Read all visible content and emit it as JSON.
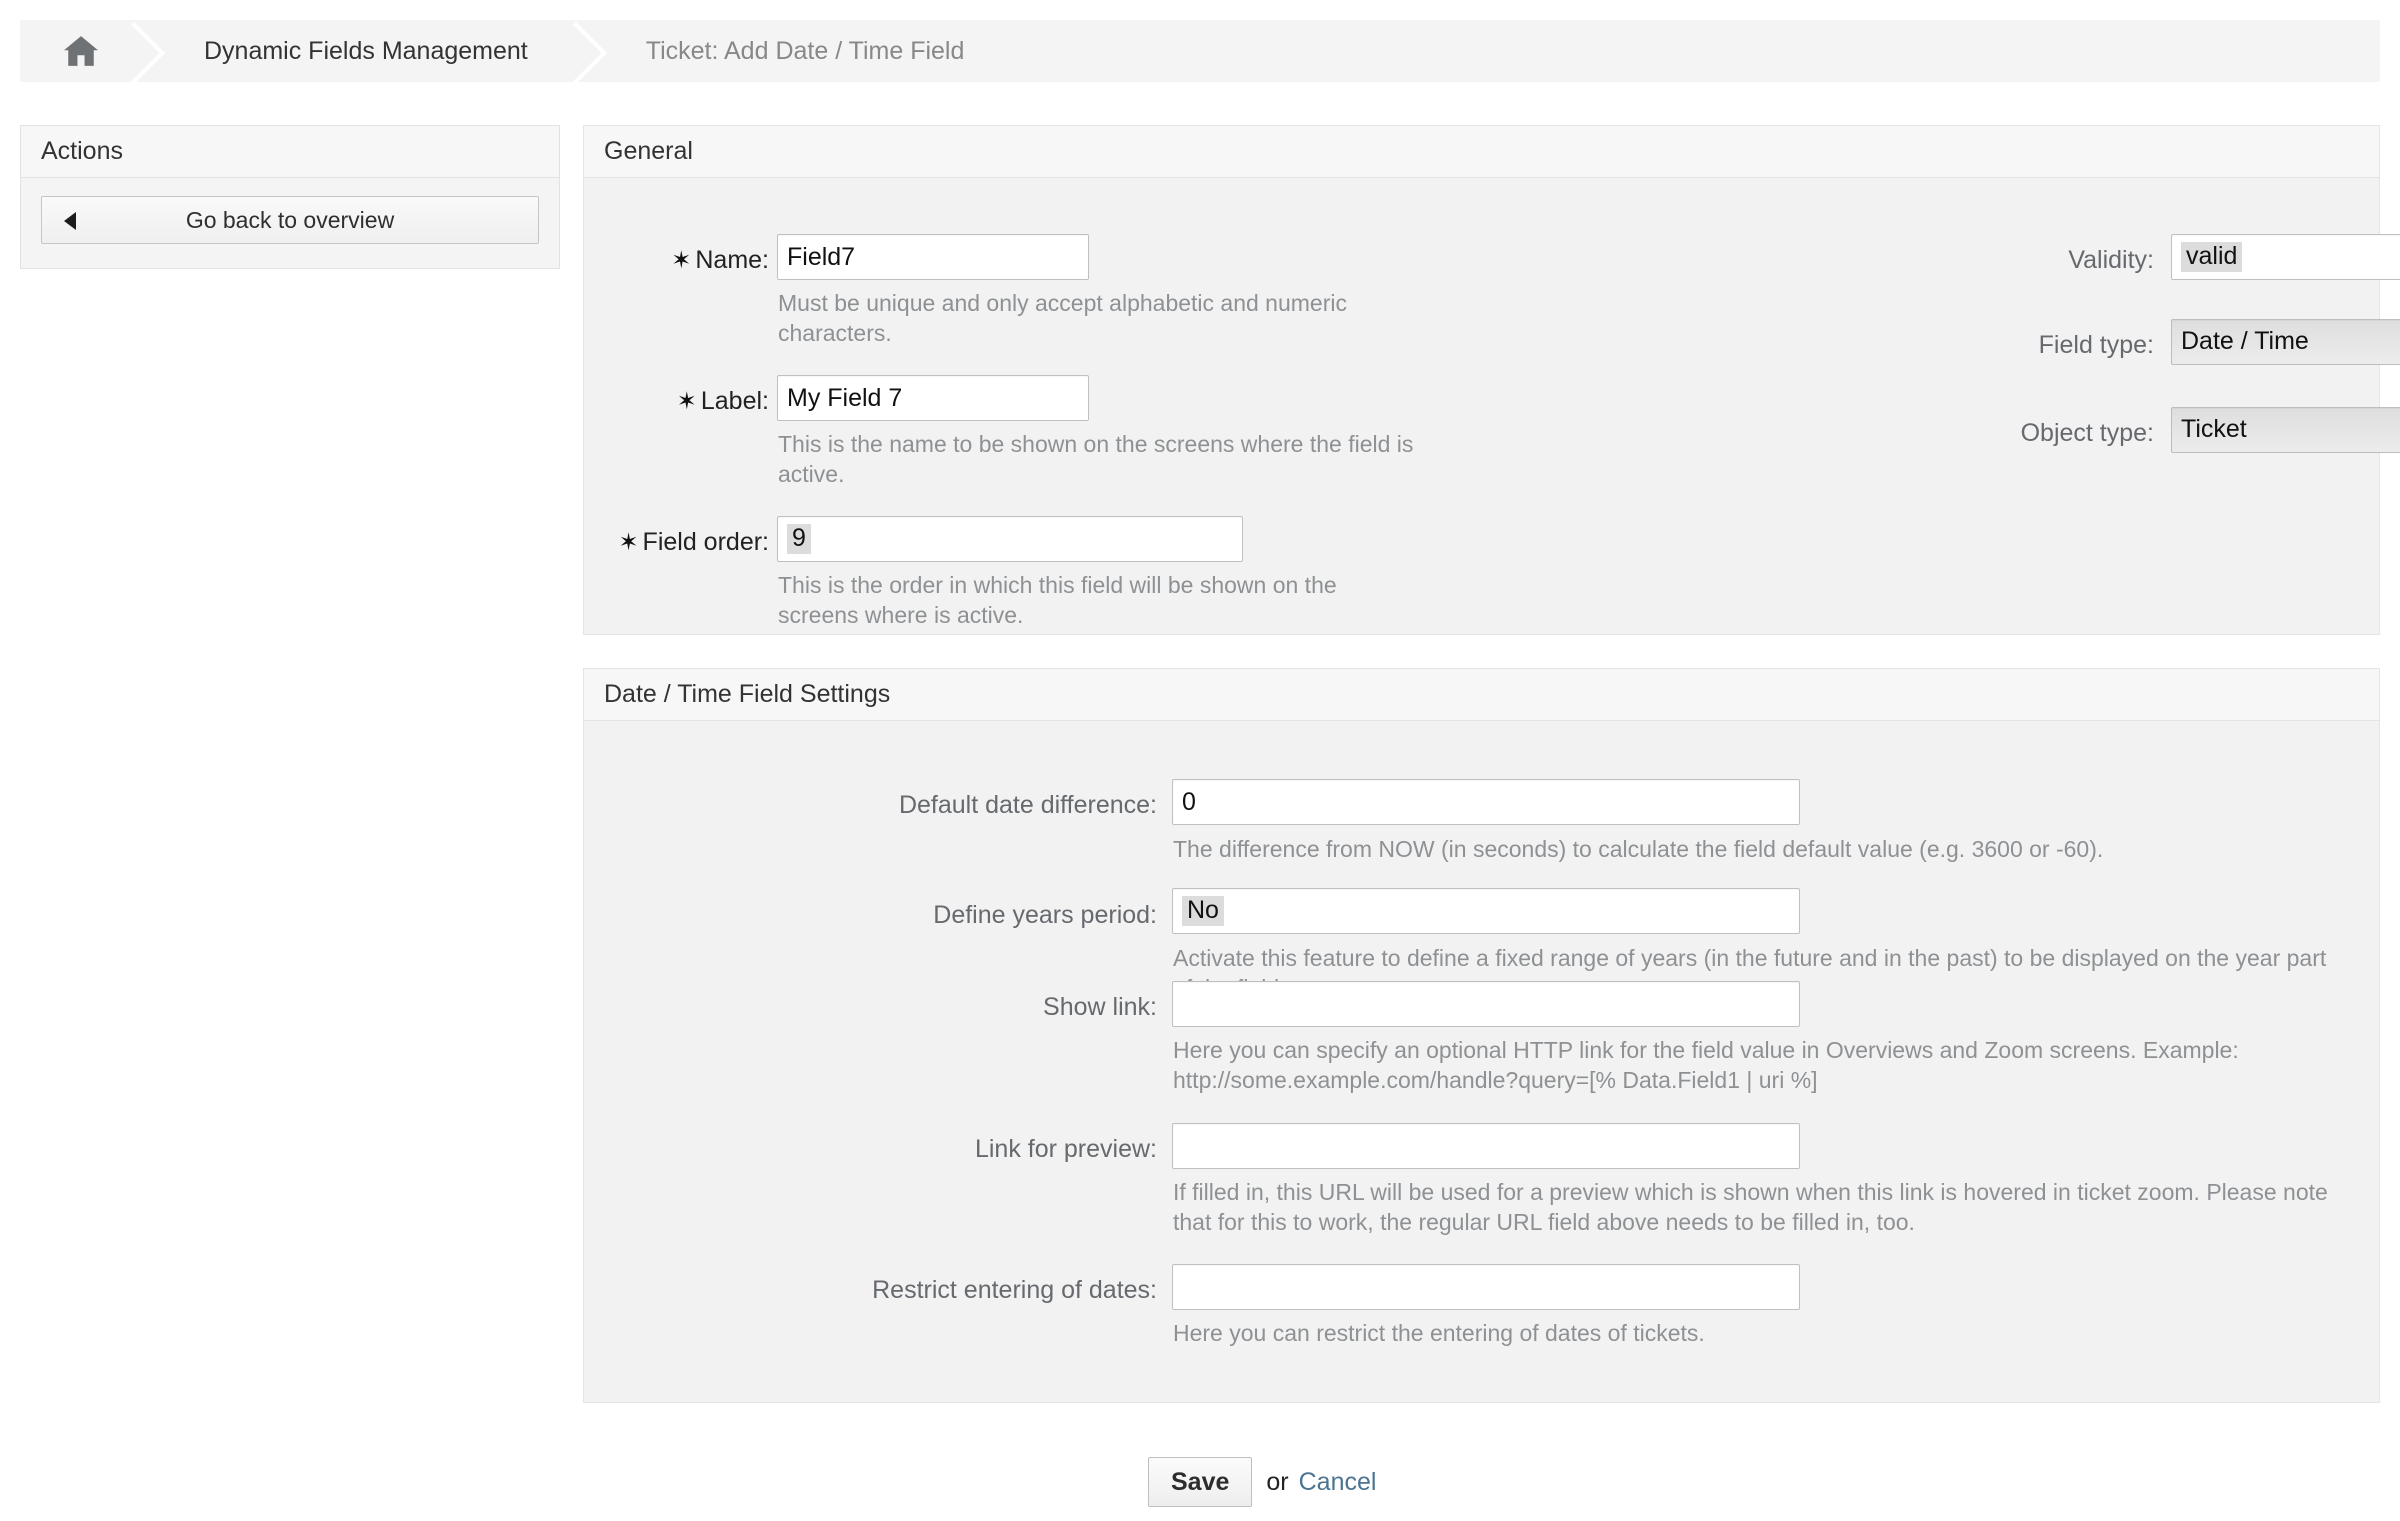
{
  "breadcrumb": {
    "home_icon": "home-icon",
    "items": [
      {
        "label": "Dynamic Fields Management",
        "muted": false
      },
      {
        "label": "Ticket: Add Date / Time Field",
        "muted": true
      }
    ]
  },
  "sidebar": {
    "title": "Actions",
    "go_back_label": "Go back to overview",
    "go_back_icon": "left-arrow-icon"
  },
  "general": {
    "title": "General",
    "name": {
      "label": "Name:",
      "required_marker": "✶",
      "value": "Field7",
      "hint": "Must be unique and only accept alphabetic and numeric characters."
    },
    "field_label": {
      "label": "Label:",
      "required_marker": "✶",
      "value": "My Field 7",
      "hint": "This is the name to be shown on the screens where the field is active."
    },
    "field_order": {
      "label": "Field order:",
      "required_marker": "✶",
      "value": "9",
      "hint": "This is the order in which this field will be shown on the screens where is active."
    },
    "validity": {
      "label": "Validity:",
      "value": "valid"
    },
    "field_type": {
      "label": "Field type:",
      "value": "Date / Time"
    },
    "object_type": {
      "label": "Object type:",
      "value": "Ticket"
    }
  },
  "datetime_settings": {
    "title": "Date / Time Field Settings",
    "default_date_difference": {
      "label": "Default date difference:",
      "value": "0",
      "hint": "The difference from NOW (in seconds) to calculate the field default value (e.g. 3600 or -60)."
    },
    "define_years_period": {
      "label": "Define years period:",
      "value": "No",
      "hint": "Activate this feature to define a fixed range of years (in the future and in the past) to be displayed on the year part of the field."
    },
    "show_link": {
      "label": "Show link:",
      "value": "",
      "hint": "Here you can specify an optional HTTP link for the field value in Overviews and Zoom screens. Example: http://some.example.com/handle?query=[% Data.Field1 | uri %]"
    },
    "link_for_preview": {
      "label": "Link for preview:",
      "value": "",
      "hint": "If filled in, this URL will be used for a preview which is shown when this link is hovered in ticket zoom. Please note that for this to work, the regular URL field above needs to be filled in, too."
    },
    "restrict_entering_of_dates": {
      "label": "Restrict entering of dates:",
      "value": "",
      "hint": "Here you can restrict the entering of dates of tickets."
    }
  },
  "footer": {
    "save_label": "Save",
    "or_label": "or",
    "cancel_label": "Cancel"
  },
  "colors": {
    "link": "#4c7491",
    "panel_bg": "#f2f2f2",
    "header_bg": "#f7f7f7",
    "hint_text": "#8e9194"
  }
}
